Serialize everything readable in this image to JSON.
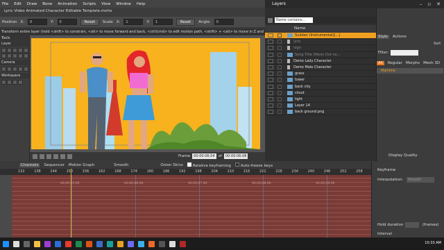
{
  "menu": [
    "File",
    "Edit",
    "Draw",
    "Bone",
    "Animation",
    "Scripts",
    "View",
    "Window",
    "Help"
  ],
  "window_title": "Lyric Video Animated Character Editable Template.moho",
  "toolbar": {
    "position_label": "Position",
    "x_label": "X:",
    "x_value": "0",
    "y_label": "Y:",
    "y_value": "0",
    "reset1": "Reset",
    "scale_label": "Scale",
    "sx_label": "X:",
    "sx_value": "1",
    "sy_label": "Y:",
    "sy_value": "1",
    "reset2": "Reset",
    "angle_label": "Angle:",
    "angle_value": "0"
  },
  "hint": "Transform entire layer (hold <shift> to constrain, <alt> to move forward and back, <ctrl/cmd> to edit motion path, <shift> + <alt> to move in Z and <ctrl/cmd> + <alt> to...",
  "tools_label": "Tools",
  "tools_sections": [
    "Layer",
    "Camera",
    "Workspace"
  ],
  "layers_panel": {
    "title": "Layers",
    "search_placeholder": "Name contains...",
    "column_name": "Name",
    "rows": [
      {
        "name": "Sudden (Instrumental)[...]",
        "selected": true,
        "dim": false,
        "group": false
      },
      {
        "name": "lyric",
        "selected": false,
        "dim": true,
        "group": true
      },
      {
        "name": "logo",
        "selected": false,
        "dim": true,
        "group": true
      },
      {
        "name": "Song Title (Here) Out no...",
        "selected": false,
        "dim": true,
        "group": false
      },
      {
        "name": "Demo Lady Character",
        "selected": false,
        "dim": false,
        "group": true
      },
      {
        "name": "Demo Male Character",
        "selected": false,
        "dim": false,
        "group": true
      },
      {
        "name": "grass",
        "selected": false,
        "dim": false,
        "group": false
      },
      {
        "name": "tower",
        "selected": false,
        "dim": false,
        "group": false
      },
      {
        "name": "back city",
        "selected": false,
        "dim": false,
        "group": false
      },
      {
        "name": "cloud",
        "selected": false,
        "dim": false,
        "group": false
      },
      {
        "name": "light",
        "selected": false,
        "dim": false,
        "group": false
      },
      {
        "name": "Layer 14",
        "selected": false,
        "dim": false,
        "group": false
      },
      {
        "name": "back ground.png",
        "selected": false,
        "dim": false,
        "group": false
      }
    ]
  },
  "side_panel": {
    "tabs": [
      "Style",
      "Actions"
    ],
    "filter_label": "Filter:",
    "sort_label": "Sort",
    "subtabs": [
      "All",
      "Regular",
      "Morphs",
      "Mesh 3D"
    ],
    "mainline": "Mainline"
  },
  "frame": {
    "label": "Frame",
    "current": "00:00:06:04",
    "of": "of",
    "total": "00:00:06:08",
    "display_quality": "Display Quality"
  },
  "timeline": {
    "tabs": [
      "Channels",
      "Sequencer",
      "Motion Graph"
    ],
    "interp": "Smooth",
    "onion": "Onion Skins",
    "relative": "Relative keyframing",
    "autofreeze": "Auto-freeze keys",
    "ticks": [
      "132",
      "138",
      "144",
      "150",
      "156",
      "162",
      "168",
      "174",
      "180",
      "186",
      "192",
      "198",
      "204",
      "210",
      "216",
      "222",
      "228",
      "234",
      "240",
      "246",
      "252",
      "258"
    ],
    "timecodes": [
      "00:00:05:00",
      "00:00:06:00",
      "00:00:07:00",
      "00:00:08:00",
      "00:00:09:00",
      "00:00:10:00"
    ]
  },
  "keyframe_panel": {
    "title": "Keyframe",
    "interp_label": "Interpolation:",
    "interp_value": "Smooth",
    "hold_label": "Hold duration",
    "hold_unit": "(frames)",
    "interval_label": "Interval"
  },
  "clock": "10:33 AM"
}
